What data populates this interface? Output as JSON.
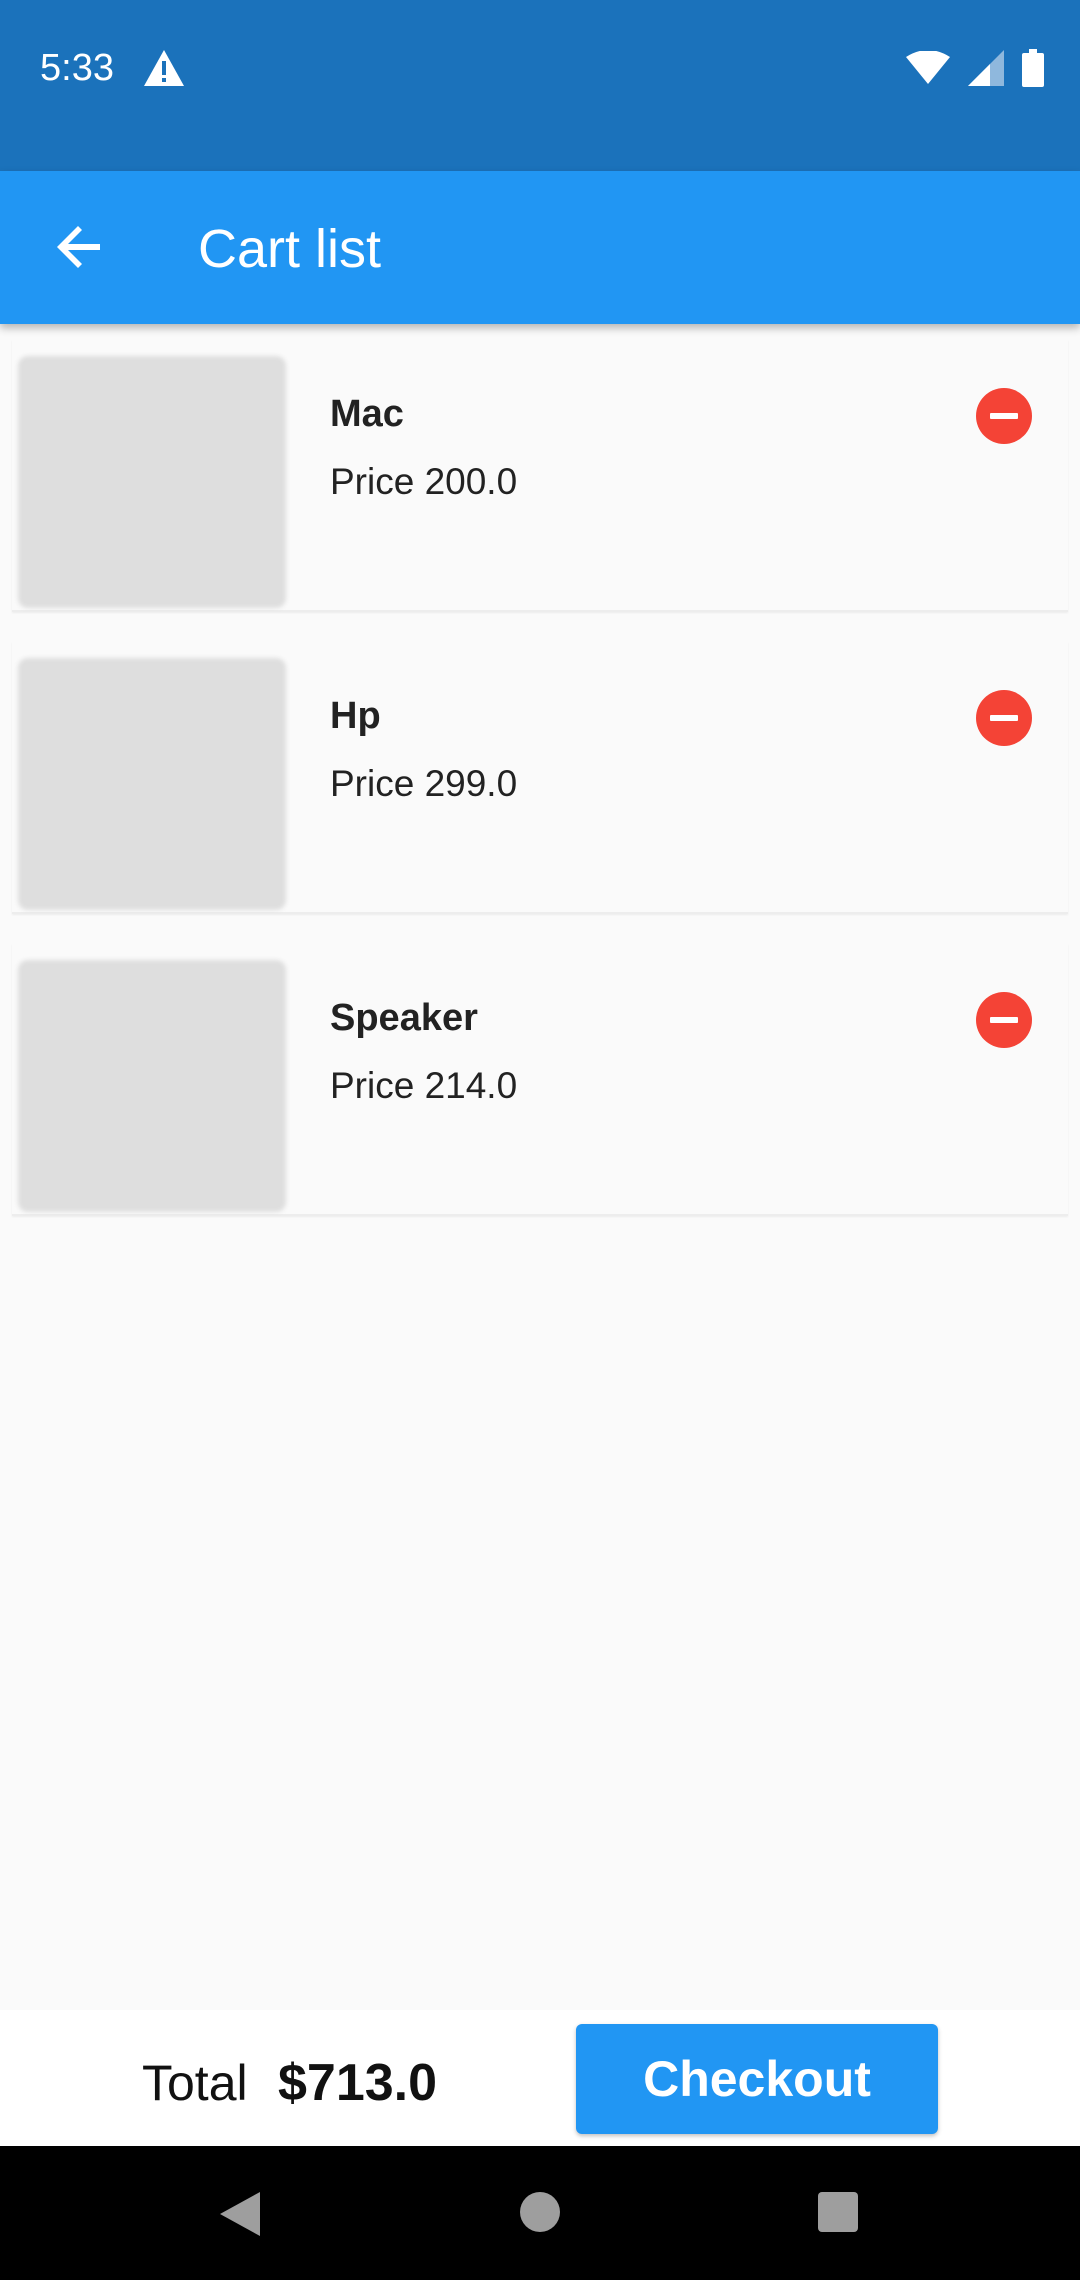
{
  "status_bar": {
    "time": "5:33",
    "icons": [
      "warning-icon",
      "wifi-icon",
      "signal-icon",
      "battery-icon"
    ]
  },
  "app_bar": {
    "title": "Cart list",
    "back_icon": "arrow-back-icon"
  },
  "cart": {
    "items": [
      {
        "name": "Mac",
        "price": "Price 200.0"
      },
      {
        "name": "Hp",
        "price": "Price 299.0"
      },
      {
        "name": "Speaker",
        "price": "Price 214.0"
      }
    ],
    "remove_icon": "remove-circle-icon"
  },
  "footer": {
    "total_label": "Total",
    "total_value": "$713.0",
    "checkout_label": "Checkout"
  },
  "colors": {
    "status_bar": "#1b72bb",
    "app_bar": "#2196f3",
    "remove": "#f44336",
    "checkout": "#2196f3"
  }
}
